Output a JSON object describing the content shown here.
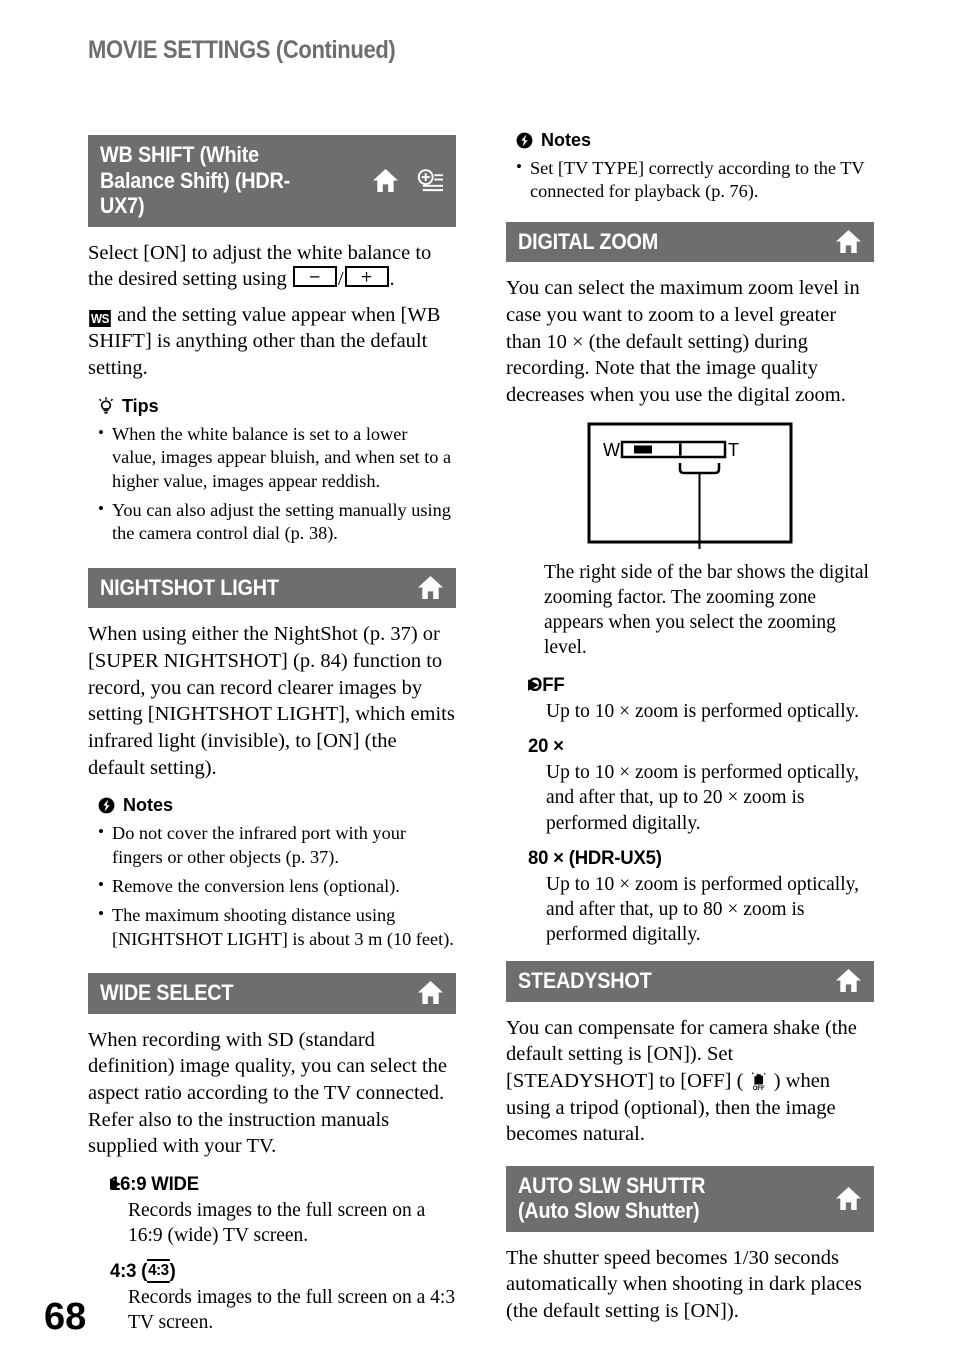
{
  "running_head": "MOVIE SETTINGS (Continued)",
  "page_number": "68",
  "colors": {
    "header_bar": "#6e6e6e",
    "running_head_text": "#6e6e6e",
    "body_text": "#000000",
    "header_bar_text": "#ffffff"
  },
  "icons": {
    "home": "home-icon",
    "option": "option-menu-icon",
    "notes": "notes-icon",
    "tips": "tips-lightbulb-icon",
    "arrow": "default-setting-arrow-icon",
    "minus_button": "minus-button-icon",
    "plus_button": "plus-button-icon",
    "ws_badge": "white-balance-shift-badge-icon",
    "ratio_43": "aspect-ratio-4-3-icon",
    "steadyshot_off": "steadyshot-off-icon"
  },
  "left_column": {
    "sections": [
      {
        "title": "WB SHIFT (White Balance Shift) (HDR-UX7)",
        "icons": [
          "home",
          "option"
        ],
        "body_parts": {
          "p1_a": "Select [ON] to adjust the white balance to the desired setting using ",
          "p1_slash": "/",
          "p1_b": ".",
          "ws_badge_label": "WS",
          "p2": " and the setting value appear when [WB SHIFT] is anything other than the default setting."
        },
        "tips": {
          "heading": "Tips",
          "items": [
            "When the white balance is set to a lower value, images appear bluish, and when set to a higher value, images appear reddish.",
            "You can also adjust the setting manually using the camera control dial (p. 38)."
          ]
        }
      },
      {
        "title": "NIGHTSHOT LIGHT",
        "icons": [
          "home"
        ],
        "body": "When using either the NightShot (p. 37) or [SUPER NIGHTSHOT] (p. 84) function to record, you can record clearer images by setting [NIGHTSHOT LIGHT], which emits infrared light (invisible), to [ON] (the default setting).",
        "notes": {
          "heading": "Notes",
          "items": [
            "Do not cover the infrared port with your fingers or other objects (p. 37).",
            "Remove the conversion lens (optional).",
            "The maximum shooting distance using [NIGHTSHOT LIGHT] is about 3 m (10 feet)."
          ]
        }
      },
      {
        "title": "WIDE SELECT",
        "icons": [
          "home"
        ],
        "body": "When recording with SD (standard definition) image quality, you can select the aspect ratio according to the TV connected. Refer also to the instruction manuals supplied with your TV.",
        "options": [
          {
            "label": "16:9 WIDE",
            "is_default": true,
            "description": "Records images to the full screen on a 16:9 (wide) TV screen."
          },
          {
            "label_prefix": "4:3 (",
            "label_icon": "4:3",
            "label_suffix": ")",
            "is_default": false,
            "description": "Records images to the full screen on a 4:3 TV screen."
          }
        ]
      }
    ]
  },
  "right_column": {
    "top_notes": {
      "heading": "Notes",
      "items": [
        "Set [TV TYPE] correctly according to the TV connected for playback (p. 76)."
      ]
    },
    "sections": [
      {
        "title": "DIGITAL ZOOM",
        "icons": [
          "home"
        ],
        "body": "You can select the maximum zoom level in case you want to zoom to a level greater than 10 × (the default setting) during recording. Note that the image quality decreases when you use the digital zoom.",
        "figure": {
          "name": "zoom-bar-diagram",
          "wide_label": "W",
          "tele_label": "T"
        },
        "figure_caption": "The right side of the bar shows the digital zooming factor. The zooming zone appears when you select the zooming level.",
        "options": [
          {
            "label": "OFF",
            "is_default": true,
            "description": "Up to 10 × zoom is performed optically."
          },
          {
            "label": "20 ×",
            "is_default": false,
            "description": "Up to 10 × zoom is performed optically, and after that, up to 20 × zoom is performed digitally."
          },
          {
            "label": "80 × (HDR-UX5)",
            "is_default": false,
            "description": "Up to 10 × zoom is performed optically, and after that, up to 80 × zoom is performed digitally."
          }
        ]
      },
      {
        "title": "STEADYSHOT",
        "icons": [
          "home"
        ],
        "body_parts": {
          "a": "You can compensate for camera shake (the default setting is [ON]). Set [STEADYSHOT] to [OFF] ( ",
          "b": " ) when using a tripod (optional), then the image becomes natural."
        }
      },
      {
        "title": "AUTO SLW SHUTTR (Auto Slow Shutter)",
        "title_line1": "AUTO SLW SHUTTR",
        "title_line2": "(Auto Slow Shutter)",
        "icons": [
          "home"
        ],
        "body": "The shutter speed becomes 1/30 seconds automatically when shooting in dark places (the default setting is [ON])."
      }
    ]
  }
}
